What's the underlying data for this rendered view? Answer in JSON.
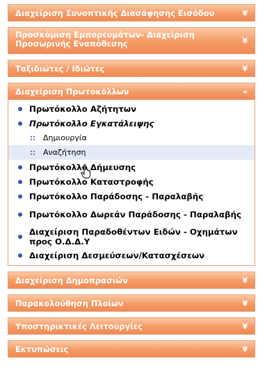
{
  "menu": {
    "sections_top": [
      {
        "label": "Διαχείριση Συνοπτικής Διασάφησης Εισόδου",
        "icon": "chevron-double-down-icon"
      },
      {
        "label": "Προσκόμιση Εμπορευμάτων- Διαχείριση Προσωρινής Εναπόθεσης",
        "icon": "chevron-double-down-icon"
      },
      {
        "label": "Ταξιδιώτες / Ιδιώτες",
        "icon": "chevron-double-down-icon"
      }
    ],
    "open_section": {
      "label": "Διαχείριση Πρωτοκόλλων",
      "icon": "chevron-double-up-icon",
      "items": [
        {
          "label": "Πρωτόκολλο Αζήτητων"
        },
        {
          "label": "Πρωτόκολλο Εγκατάλειψης",
          "sub": [
            {
              "label": "Δημιουργία"
            },
            {
              "label": "Αναζήτηση"
            }
          ]
        },
        {
          "label": "Πρωτόκολλο Δήμευσης"
        },
        {
          "label": "Πρωτόκολλο Καταστροφής"
        },
        {
          "label": "Πρωτόκολλο Παράδοσης - Παραλαβής"
        },
        {
          "label": "Πρωτόκολλο Δωρεάν Παράδοσης - Παραλαβής"
        },
        {
          "label": "Διαχείριση Παραδοθέντων Ειδών - Οχημάτων προς Ο.Δ.Δ.Υ"
        },
        {
          "label": "Διαχείριση Δεσμεύσεων/Κατασχέσεων"
        }
      ]
    },
    "sections_bottom": [
      {
        "label": "Διαχείριση Δημοπρασιών",
        "icon": "chevron-double-down-icon"
      },
      {
        "label": "Παρακολούθηση Πλοίων",
        "icon": "chevron-double-down-icon"
      },
      {
        "label": "Υποστηρικτικές Λειτουργίες",
        "icon": "chevron-double-down-icon"
      },
      {
        "label": "Εκτυπώσεις",
        "icon": "chevron-double-down-icon"
      }
    ],
    "chevron_down": "¥",
    "chevron_up": "«"
  },
  "colors": {
    "header_top": "#fbc9a3",
    "header_bottom": "#f08a54",
    "bullet": "#2f57b8",
    "highlight": "#e4eaf6"
  }
}
